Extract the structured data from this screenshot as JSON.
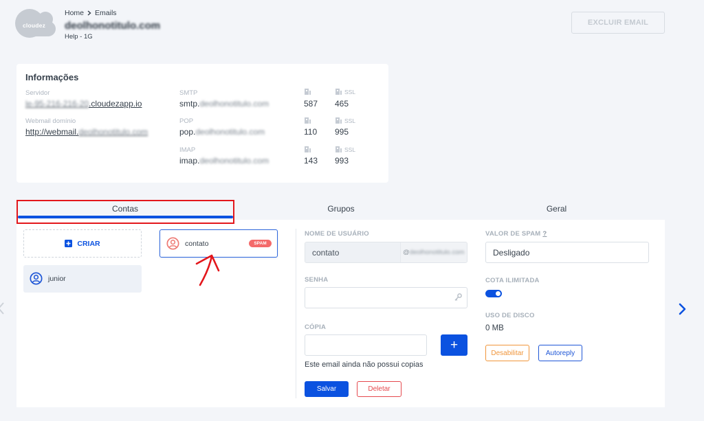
{
  "header": {
    "logo_text": "cloudez",
    "breadcrumb": {
      "home": "Home",
      "current": "Emails"
    },
    "domain": "deolhonotitulo.com",
    "plan": "Help - 1G",
    "delete_button": "EXCLUIR EMAIL"
  },
  "info": {
    "title": "Informações",
    "server": {
      "label": "Servidor",
      "host_hidden": "le-95-216-216-20",
      "host_suffix": ".cloudezapp.io"
    },
    "webmail": {
      "label": "Webmail domínio",
      "prefix": "http://webmail.",
      "domain": "deolhonotitulo.com"
    },
    "ssl_label": "SSL",
    "protocols": [
      {
        "label": "SMTP",
        "prefix": "smtp.",
        "domain": "deolhonotitulo.com",
        "port": "587",
        "ssl_port": "465"
      },
      {
        "label": "POP",
        "prefix": "pop.",
        "domain": "deolhonotitulo.com",
        "port": "110",
        "ssl_port": "995"
      },
      {
        "label": "IMAP",
        "prefix": "imap.",
        "domain": "deolhonotitulo.com",
        "port": "143",
        "ssl_port": "993"
      }
    ]
  },
  "tabs": {
    "active_index": 0,
    "items": [
      "Contas",
      "Grupos",
      "Geral"
    ]
  },
  "accounts": {
    "create_label": "CRIAR",
    "items": [
      {
        "name": "contato",
        "badge": "SPAM",
        "selected": true
      },
      {
        "name": "junior",
        "selected": false
      }
    ]
  },
  "form": {
    "username": {
      "label": "NOME DE USUÁRIO",
      "value": "contato",
      "domain_at": "@",
      "domain": "deolhonotitulo.com"
    },
    "password": {
      "label": "SENHA"
    },
    "copy": {
      "label": "CÓPIA",
      "add_button": "+",
      "empty_text": "Este email ainda não possui copias"
    },
    "save_button": "Salvar",
    "delete_button": "Deletar",
    "spam": {
      "label": "VALOR DE SPAM",
      "help": "?",
      "value": "Desligado"
    },
    "unlimited_quota": {
      "label": "COTA ILIMITADA",
      "enabled": true
    },
    "disk_usage": {
      "label": "USO DE DISCO",
      "value": "0 MB"
    },
    "disable_button": "Desabilitar",
    "autoreply_button": "Autoreply"
  },
  "colors": {
    "background": "#f3f5f9",
    "accent": "#0b52e0",
    "text": "#353f4a",
    "label": "#a7b0ba",
    "spam_badge": "#f46a6a",
    "danger": "#e5484d",
    "warning": "#f0953a",
    "annotation": "#e3161b"
  },
  "icons": {
    "logo": "cloud-logo-icon",
    "breadcrumb_separator": "chevron-right-icon",
    "port": "port-icon",
    "create": "plus-square-icon",
    "account": "user-circle-icon",
    "password": "key-icon",
    "next": "chevron-right-icon",
    "previous": "chevron-left-icon"
  }
}
